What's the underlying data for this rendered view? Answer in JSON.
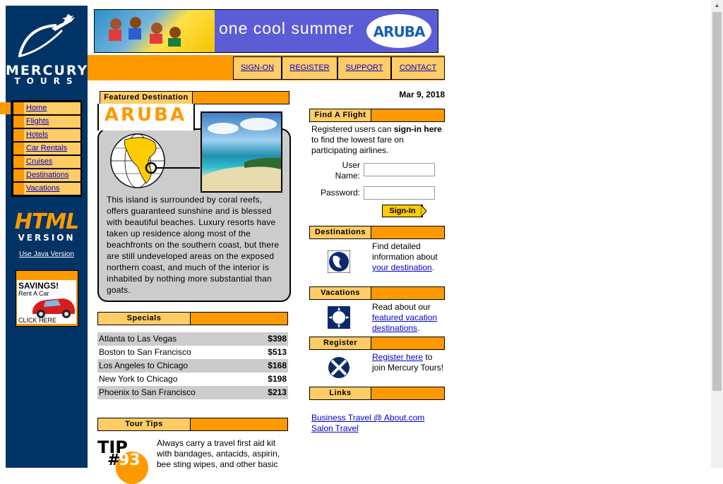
{
  "brand": {
    "title": "MERCURY",
    "subtitle": "TOURS"
  },
  "sidebar": {
    "nav": [
      {
        "label": "Home"
      },
      {
        "label": "Flights"
      },
      {
        "label": "Hotels"
      },
      {
        "label": "Car Rentals"
      },
      {
        "label": "Cruises"
      },
      {
        "label": "Destinations"
      },
      {
        "label": "Vacations"
      }
    ],
    "html_version_big": "HTML",
    "html_version_small": "VERSION",
    "java_link": "Use Java Version",
    "ad": {
      "headline": "SAVINGS!",
      "subline": "Rent A Car",
      "cta": "CLICK HERE"
    }
  },
  "banner": {
    "text": "one cool summer",
    "logo": "ARUBA"
  },
  "topnav": [
    {
      "label": "SIGN-ON"
    },
    {
      "label": "REGISTER"
    },
    {
      "label": "SUPPORT"
    },
    {
      "label": "CONTACT"
    }
  ],
  "featured": {
    "header": "Featured Destination",
    "name": "ARUBA",
    "description": "This island is surrounded by coral reefs, offers guaranteed sunshine and is blessed with beautiful beaches. Luxury resorts have taken up residence along most of the beachfronts on the southern coast, but there are still undeveloped areas on the exposed northern coast, and much of the interior is inhabited by nothing more substantial than goats."
  },
  "specials": {
    "header": "Specials",
    "rows": [
      {
        "route": "Atlanta to Las Vegas",
        "price": "$398"
      },
      {
        "route": "Boston to San Francisco",
        "price": "$513"
      },
      {
        "route": "Los Angeles to Chicago",
        "price": "$168"
      },
      {
        "route": "New York to Chicago",
        "price": "$198"
      },
      {
        "route": "Phoenix to San Francisco",
        "price": "$213"
      }
    ]
  },
  "tour_tips": {
    "header": "Tour Tips",
    "tip_word": "TIP",
    "tip_number": "93",
    "text": "Always carry a travel first aid kit with bandages, antacids, aspirin, bee sting wipes, and other basic"
  },
  "date": "Mar 9, 2018",
  "find_flight": {
    "header": "Find A Flight",
    "intro_1": "Registered users can ",
    "intro_bold": "sign-in here",
    "intro_2": " to find the lowest fare on participating airlines.",
    "user_label": "User Name:",
    "password_label": "Password:",
    "signin_button": "Sign-In"
  },
  "destinations": {
    "header": "Destinations",
    "text_1": "Find detailed information about ",
    "link": "your destination",
    "text_2": "."
  },
  "vacations": {
    "header": "Vacations",
    "text_1": "Read about our ",
    "link": "featured vacation destinations",
    "text_2": "."
  },
  "register": {
    "header": "Register",
    "link": "Register here",
    "text_2": " to join Mercury Tours!"
  },
  "links": {
    "header": "Links",
    "items": [
      "Business Travel @ About.com",
      "Salon Travel"
    ]
  }
}
